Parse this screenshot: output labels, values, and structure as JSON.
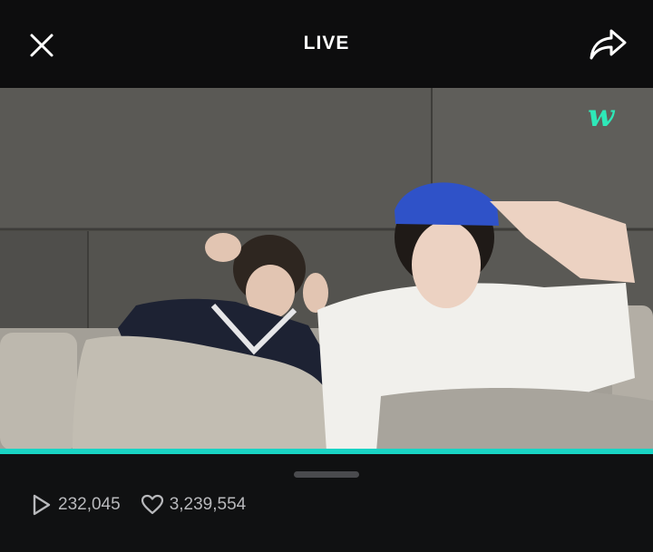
{
  "header": {
    "title": "LIVE"
  },
  "video": {
    "watermark_label": "w"
  },
  "stats": {
    "views": "232,045",
    "likes": "3,239,554"
  },
  "colors": {
    "accent": "#19d4c4",
    "background": "#0d0d0e"
  },
  "icons": {
    "close": "close-icon",
    "share": "share-icon",
    "play": "play-icon",
    "heart": "heart-icon"
  }
}
